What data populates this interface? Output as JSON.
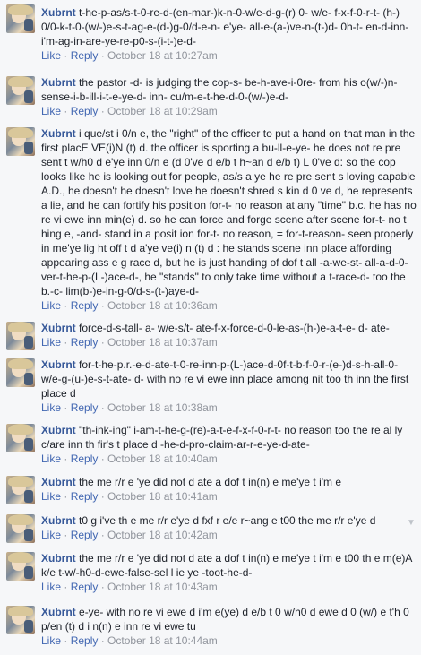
{
  "comments": [
    {
      "author": "Xubrnt",
      "text": "t-he-p-as/s-t-0-re-d-(en-mar-)k-n-0-w/e-d-g-(r) 0- w/e- f-x-f-0-r-t- (h-) 0/0-k-t-0-(w/-)e-s-t-ag-e-(d-)g-0/d-e-n- e'ye- all-e-(a-)ve-n-(t-)d- 0h-t- en-d-inn-i'm-ag-in-are-ye-re-p0-s-(i-t-)e-d-",
      "like": "Like",
      "reply": "Reply",
      "time": "October 18 at 10:27am"
    },
    {
      "author": "Xubrnt",
      "text": "the pastor -d- is judging the cop-s- be-h-ave-i-0re- from his o(w/-)n-sense-i-b-ill-i-t-e-ye-d- inn- cu/m-e-t-he-d-0-(w/-)e-d-",
      "like": "Like",
      "reply": "Reply",
      "time": "October 18 at 10:29am"
    },
    {
      "author": "Xubrnt",
      "text": "i que/st i 0/n e, the \"right\" of the officer to put a hand on that man in the first placE VE(i)N (t) d. the officer is sporting a bu-ll-e-ye- he does not re pre sent t w/h0 d e'ye inn 0/n e (d 0've d e/b t h~an d e/b t) L 0've d: so the cop looks like he is looking out for people, as/s a ye he re pre sent s loving capable A.D., he doesn't he doesn't love he doesn't shred s kin d 0 ve d, he represents a lie, and he can fortify his position for-t- no reason at any \"time\" b.c. he has no re vi ewe inn min(e) d. so he can force and forge scene after scene for-t- no t hing e, -and- stand in a posit ion for-t- no reason, = for-t-reason- seen properly in me'ye lig ht off t d a'ye ve(i) n (t) d : he stands scene inn place affording appearing ass e g race d, but he is just handing of dof t all -a-we-st- all-a-d-0-ver-t-he-p-(L-)ace-d-, he \"stands\" to only take time without a t-race-d- too the b.-c- lim(b-)e-in-g-0/d-s-(t-)aye-d-",
      "like": "Like",
      "reply": "Reply",
      "time": "October 18 at 10:36am"
    },
    {
      "author": "Xubrnt",
      "text": "force-d-s-tall- a- w/e-s/t- ate-f-x-force-d-0-le-as-(h-)e-a-t-e- d- ate-",
      "like": "Like",
      "reply": "Reply",
      "time": "October 18 at 10:37am"
    },
    {
      "author": "Xubrnt",
      "text": "for-t-he-p.r.-e-d-ate-t-0-re-inn-p-(L-)ace-d-0f-t-b-f-0-r-(e-)d-s-h-all-0-w/e-g-(u-)e-s-t-ate- d- with no re vi ewe inn place among nit too th inn the first place d",
      "like": "Like",
      "reply": "Reply",
      "time": "October 18 at 10:38am"
    },
    {
      "author": "Xubrnt",
      "text": "\"th-ink-ing\" i-am-t-he-g-(re)-a-t-e-f-x-f-0-r-t- no reason too the re al ly c/are inn th fir's t place d -he-d-pro-claim-ar-r-e-ye-d-ate-",
      "like": "Like",
      "reply": "Reply",
      "time": "October 18 at 10:40am"
    },
    {
      "author": "Xubrnt",
      "text": "the me r/r e 'ye did not d ate a dof t in(n) e me'ye t i'm e",
      "like": "Like",
      "reply": "Reply",
      "time": "October 18 at 10:41am"
    },
    {
      "author": "Xubrnt",
      "text": "t0 g i've th e me r/r e'ye d fxf r e/e r~ang e t00 the me r/r e'ye d",
      "like": "Like",
      "reply": "Reply",
      "time": "October 18 at 10:42am"
    },
    {
      "author": "Xubrnt",
      "text": "the me r/r e 'ye did not d ate a dof t in(n) e me'ye t i'm e t00 th e m(e)A k/e t-w/-h0-d-ewe-false-sel l ie ye -toot-he-d-",
      "like": "Like",
      "reply": "Reply",
      "time": "October 18 at 10:43am"
    },
    {
      "author": "Xubrnt",
      "text": "e-ye- with no re vi ewe d i'm e(ye) d e/b t 0 w/h0 d ewe d 0 (w/) e t'h 0 p/en (t) d i n(n) e inn re vi ewe tu",
      "like": "Like",
      "reply": "Reply",
      "time": "October 18 at 10:44am"
    }
  ],
  "ui": {
    "separator": " · ",
    "options_icon": "chevron-down-icon"
  }
}
